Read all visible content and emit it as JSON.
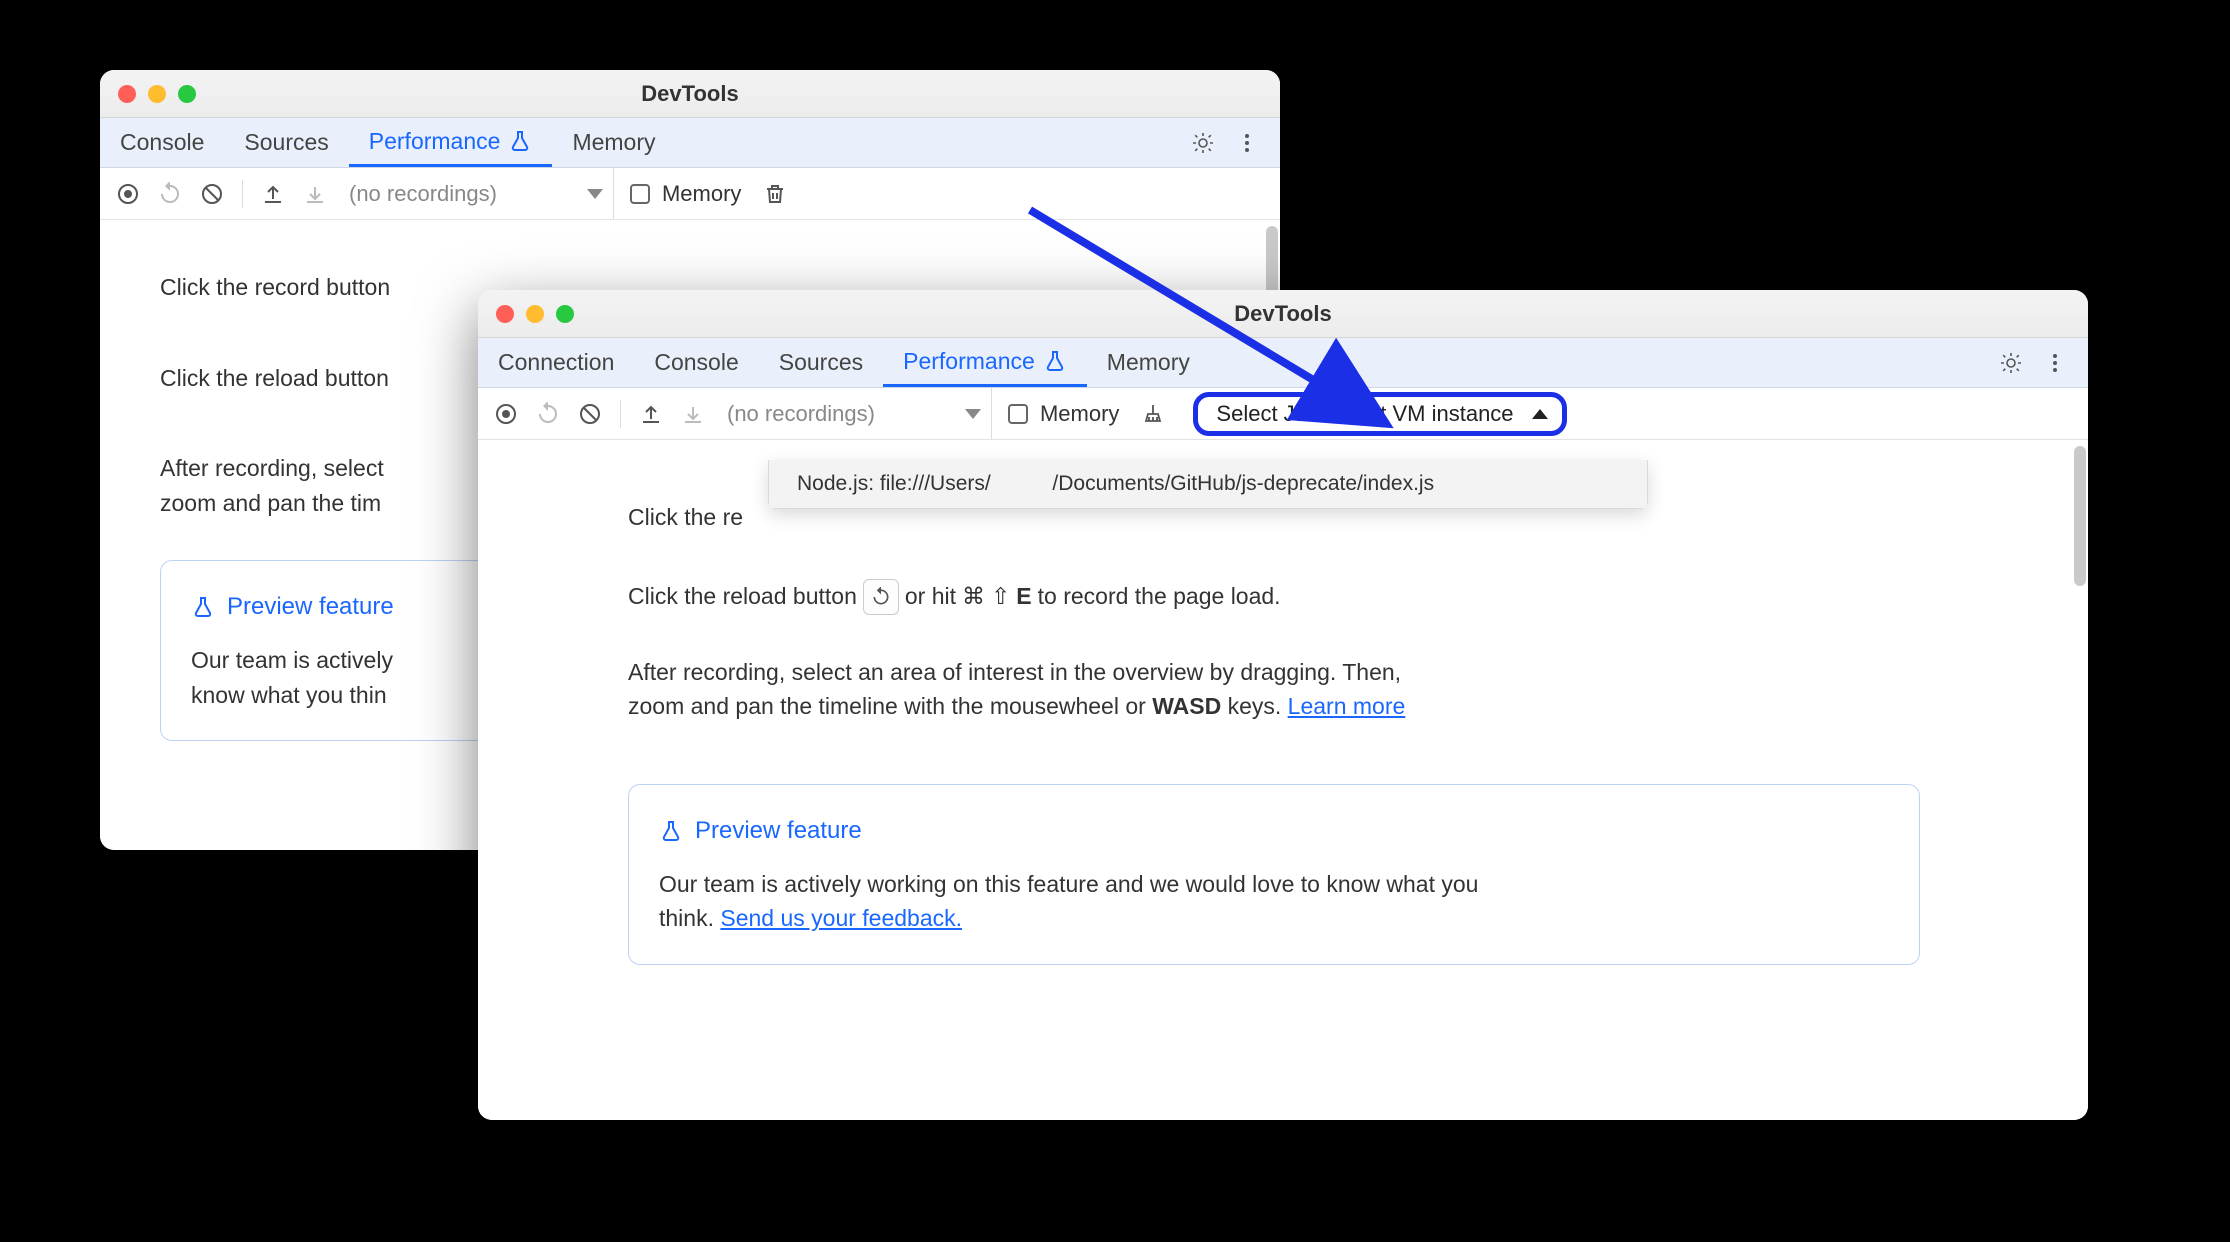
{
  "win1": {
    "title": "DevTools",
    "tabs": {
      "console": "Console",
      "sources": "Sources",
      "performance": "Performance",
      "memory": "Memory"
    },
    "toolbar": {
      "recordings_placeholder": "(no recordings)",
      "memory_label": "Memory"
    },
    "instructions": {
      "record_prefix": "Click the record button",
      "reload_prefix": "Click the reload button",
      "after_prefix": "After recording, select",
      "after_line2": "zoom and pan the tim"
    },
    "preview": {
      "title": "Preview feature",
      "body_line1": "Our team is actively",
      "body_line2": "know what you thin"
    }
  },
  "win2": {
    "title": "DevTools",
    "tabs": {
      "connection": "Connection",
      "console": "Console",
      "sources": "Sources",
      "performance": "Performance",
      "memory": "Memory"
    },
    "toolbar": {
      "recordings_placeholder": "(no recordings)",
      "memory_label": "Memory",
      "vm_select_label": "Select JavaScript VM instance"
    },
    "vm_dropdown": {
      "item_prefix": "Node.js: file:///Users/",
      "item_suffix": "/Documents/GitHub/js-deprecate/index.js"
    },
    "instructions": {
      "record_prefix": "Click the re",
      "reload_prefix": "Click the reload button",
      "reload_suffix_1": "or hit",
      "reload_key_cmd": "⌘",
      "reload_key_shift": "⇧",
      "reload_key_e": "E",
      "reload_suffix_2": "to record the page load.",
      "after_line1": "After recording, select an area of interest in the overview by dragging. Then,",
      "after_line2_a": "zoom and pan the timeline with the mousewheel or ",
      "after_wasd": "WASD",
      "after_line2_b": " keys. ",
      "learn_more": "Learn more"
    },
    "preview": {
      "title": "Preview feature",
      "body_a": "Our team is actively working on this feature and we would love to know what you think. ",
      "feedback_link": "Send us your feedback."
    }
  }
}
